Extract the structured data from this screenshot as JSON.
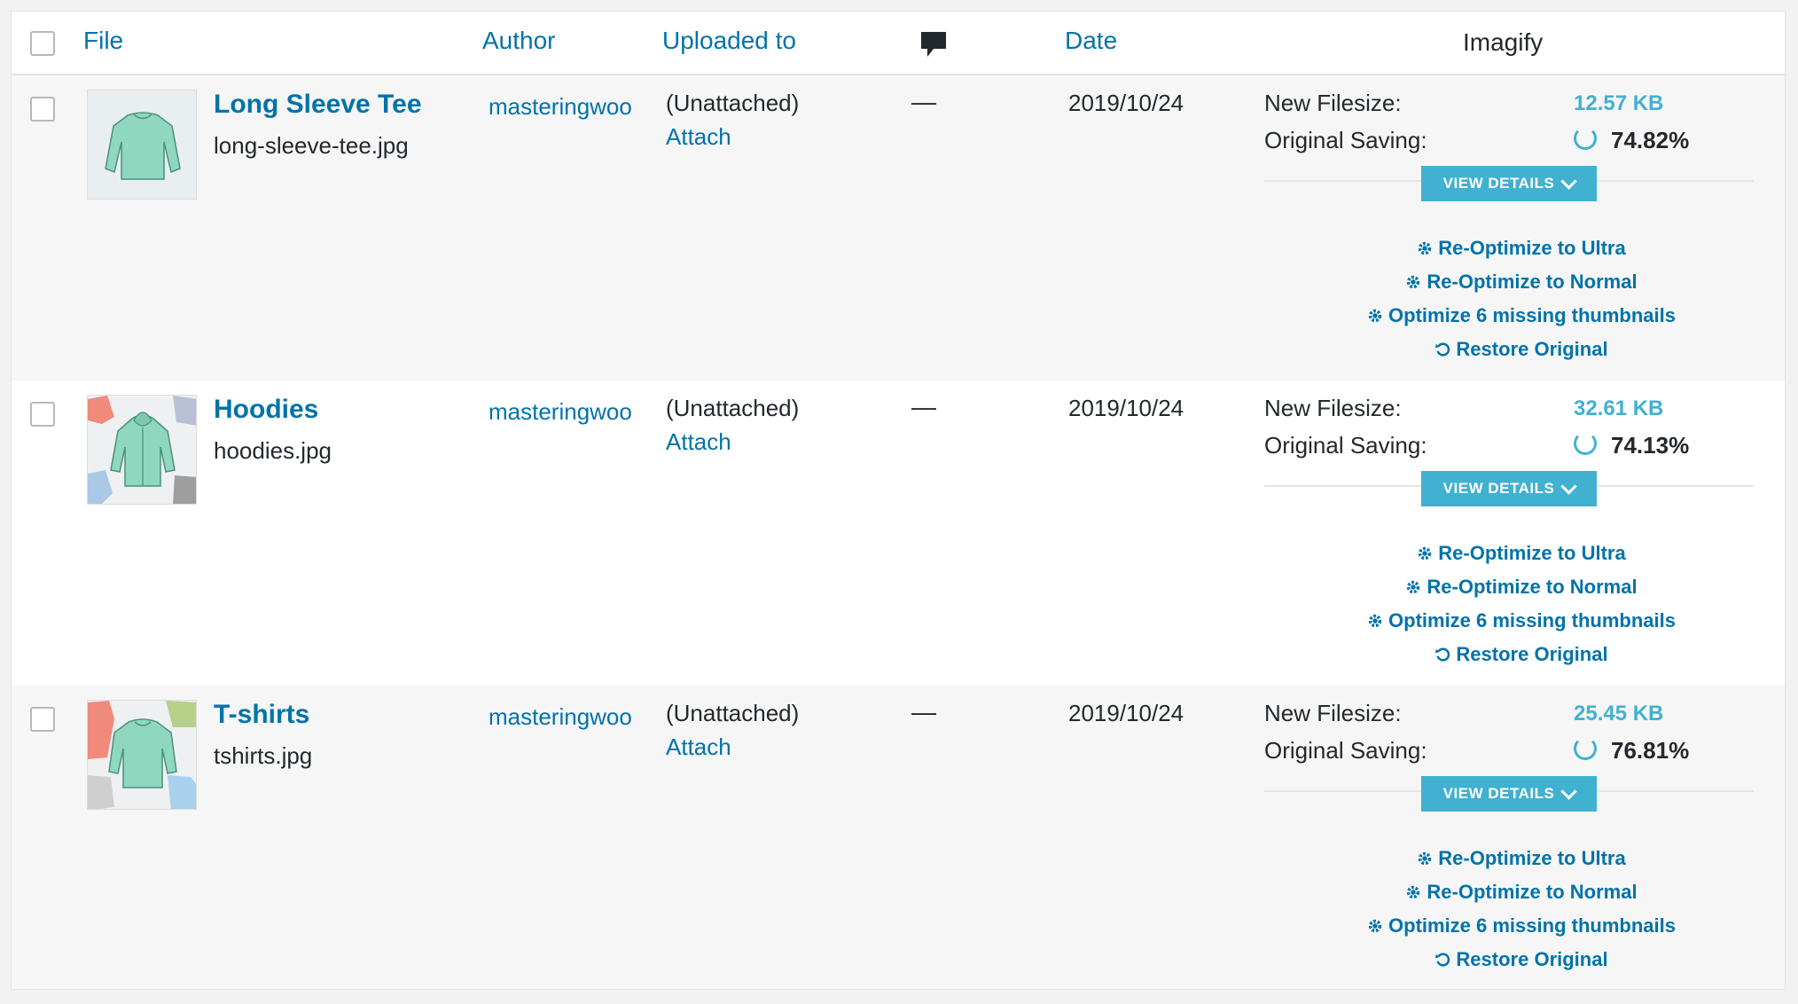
{
  "header": {
    "file": "File",
    "author": "Author",
    "uploaded_to": "Uploaded to",
    "comments_icon": "comment-bubble-icon",
    "date": "Date",
    "imagify": "Imagify"
  },
  "labels": {
    "new_filesize": "New Filesize:",
    "original_saving": "Original Saving:",
    "view_details": "VIEW DETAILS",
    "reopt_ultra": "Re-Optimize to Ultra",
    "reopt_normal": "Re-Optimize to Normal",
    "optimize_missing": "Optimize 6 missing thumbnails",
    "restore": "Restore Original"
  },
  "colors": {
    "link": "#0073aa",
    "imagify_accent": "#40b1d0"
  },
  "rows": [
    {
      "title": "Long Sleeve Tee",
      "filename": "long-sleeve-tee.jpg",
      "author": "masteringwoo",
      "uploaded_to": "(Unattached)",
      "attach": "Attach",
      "comments": "—",
      "date": "2019/10/24",
      "new_filesize": "12.57 KB",
      "original_saving": "74.82%"
    },
    {
      "title": "Hoodies",
      "filename": "hoodies.jpg",
      "author": "masteringwoo",
      "uploaded_to": "(Unattached)",
      "attach": "Attach",
      "comments": "—",
      "date": "2019/10/24",
      "new_filesize": "32.61 KB",
      "original_saving": "74.13%"
    },
    {
      "title": "T-shirts",
      "filename": "tshirts.jpg",
      "author": "masteringwoo",
      "uploaded_to": "(Unattached)",
      "attach": "Attach",
      "comments": "—",
      "date": "2019/10/24",
      "new_filesize": "25.45 KB",
      "original_saving": "76.81%"
    }
  ]
}
